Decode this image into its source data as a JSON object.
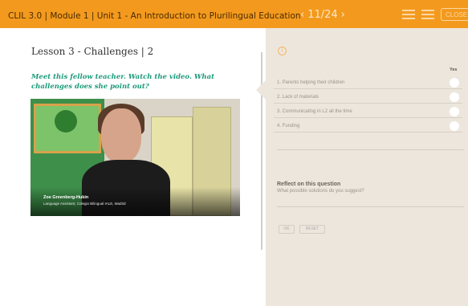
{
  "topbar": {
    "course_title": "CLIL 3.0 | Module 1 | Unit 1 - An Introduction to Plurilingual Education",
    "pager": {
      "prev_icon": "‹",
      "current": "11/24",
      "next_icon": "›"
    },
    "close_label": "CLOSE",
    "icons": [
      "menu-icon",
      "list-icon"
    ]
  },
  "lesson": {
    "title": "Lesson 3 - Challenges | 2",
    "prompt": "Meet this fellow teacher. Watch the video. What challenges does she point out?",
    "video": {
      "speaker_name": "Zoe Greenberg-Hukin",
      "speaker_role": "Language Assistant, Colegio Bilingual IALE, Madrid"
    }
  },
  "quiz": {
    "info_icon": "i",
    "column_header": "Yes",
    "options": [
      "1. Parents helping their children",
      "2. Lack of materials",
      "3. Communicating in L2 all the time",
      "4. Funding"
    ],
    "reflect_title": "Reflect on this question",
    "reflect_question": "What possible solutions do you suggest?",
    "ok_label": "OK",
    "reset_label": "RESET"
  },
  "colors": {
    "accent": "#f39a1e",
    "panel": "#ede6dd",
    "prompt": "#1a9a7a"
  }
}
